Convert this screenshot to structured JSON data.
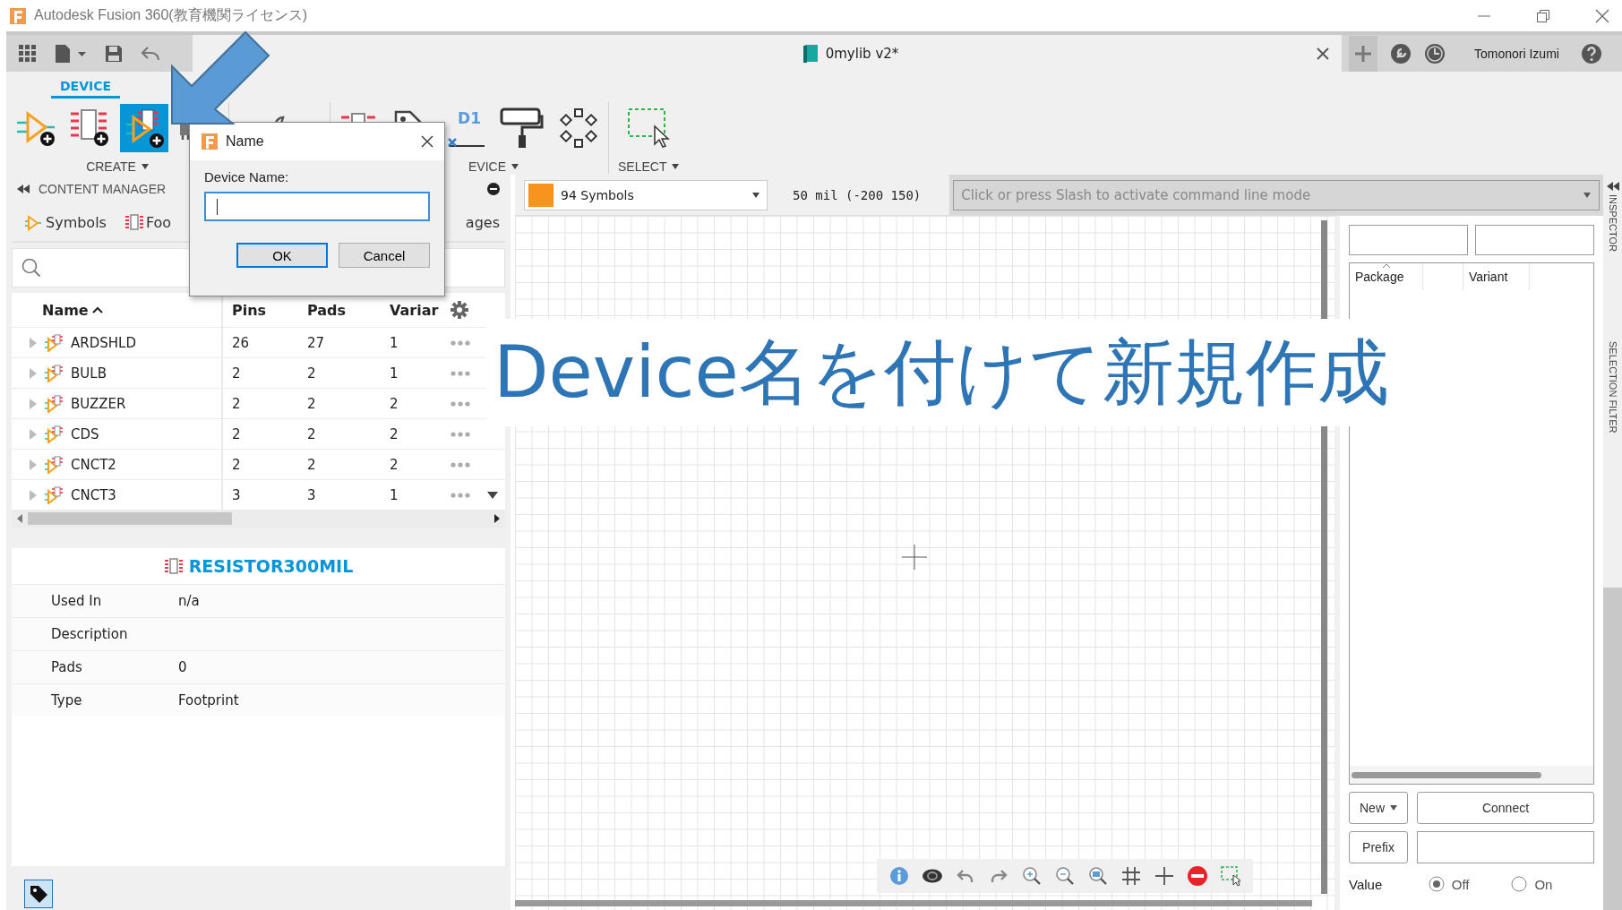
{
  "window": {
    "title": "Autodesk Fusion 360(教育機関ライセンス)"
  },
  "app_bar": {
    "document_tab": {
      "title": "0mylib v2*"
    },
    "user": "Tomonori Izumi"
  },
  "toolbar": {
    "tabs": [
      {
        "label": "DEVICE",
        "selected": true
      }
    ],
    "groups": [
      {
        "label": "CREATE",
        "tools": [
          {
            "kind": "symbol",
            "selected": false
          },
          {
            "kind": "footprint",
            "selected": false
          },
          {
            "kind": "device",
            "selected": true
          },
          {
            "kind": "package",
            "selected": false
          }
        ]
      },
      {
        "tools": [
          {
            "kind": "wrench",
            "selected": false
          }
        ]
      },
      {
        "label": "EVICE",
        "tools": [
          {
            "kind": "footprint-plain",
            "selected": false
          },
          {
            "kind": "tag",
            "selected": false
          },
          {
            "kind": "name",
            "text": "D1",
            "selected": false
          },
          {
            "kind": "roller",
            "selected": false
          },
          {
            "kind": "pads",
            "selected": false
          }
        ]
      },
      {
        "label": "SELECT",
        "tools": [
          {
            "kind": "select",
            "selected": false
          }
        ]
      }
    ]
  },
  "content_manager": {
    "title": "CONTENT MANAGER",
    "tabs": [
      {
        "label": "Symbols",
        "kind": "symbol"
      },
      {
        "label": "Foo",
        "kind": "footprint"
      },
      {
        "label": "ages",
        "kind": "none"
      }
    ],
    "table": {
      "columns": [
        "Name",
        "Pins",
        "Pads",
        "Variar"
      ],
      "rows": [
        {
          "name": "ARDSHLD",
          "pins": "26",
          "pads": "27",
          "variants": "1",
          "expanded": false
        },
        {
          "name": "BULB",
          "pins": "2",
          "pads": "2",
          "variants": "1",
          "expanded": false
        },
        {
          "name": "BUZZER",
          "pins": "2",
          "pads": "2",
          "variants": "2",
          "expanded": false
        },
        {
          "name": "CDS",
          "pins": "2",
          "pads": "2",
          "variants": "2",
          "expanded": false
        },
        {
          "name": "CNCT2",
          "pins": "2",
          "pads": "2",
          "variants": "2",
          "expanded": false
        },
        {
          "name": "CNCT3",
          "pins": "3",
          "pads": "3",
          "variants": "1",
          "expanded": false
        }
      ]
    },
    "details": {
      "title": "RESISTOR300MIL",
      "properties": [
        {
          "label": "Used In",
          "value": "n/a"
        },
        {
          "label": "Description"
        },
        {
          "label": "Pads",
          "value": "0"
        },
        {
          "label": "Type",
          "value": "Footprint"
        }
      ]
    }
  },
  "canvas_bar": {
    "layer": {
      "value": "94 Symbols",
      "color": "#f7941d"
    },
    "coordinates": "50 mil (-200 150)",
    "command_line": {
      "placeholder": "Click or press Slash to activate command line mode"
    }
  },
  "device_panel": {
    "columns": [
      "Package",
      "Variant"
    ],
    "buttons": {
      "new": "New",
      "connect": "Connect",
      "prefix": "Prefix"
    },
    "value": {
      "label": "Value",
      "options": [
        {
          "label": "Off",
          "selected": true
        },
        {
          "label": "On",
          "selected": false
        }
      ]
    }
  },
  "side_tabs": [
    "INSPECTOR",
    "SELECTION FILTER"
  ],
  "dialog": {
    "title": "Name",
    "field_label": "Device Name:",
    "buttons": [
      {
        "label": "OK",
        "default": true
      },
      {
        "label": "Cancel",
        "default": false
      }
    ]
  },
  "annotation": {
    "text": "Device名を付けて新規作成"
  }
}
